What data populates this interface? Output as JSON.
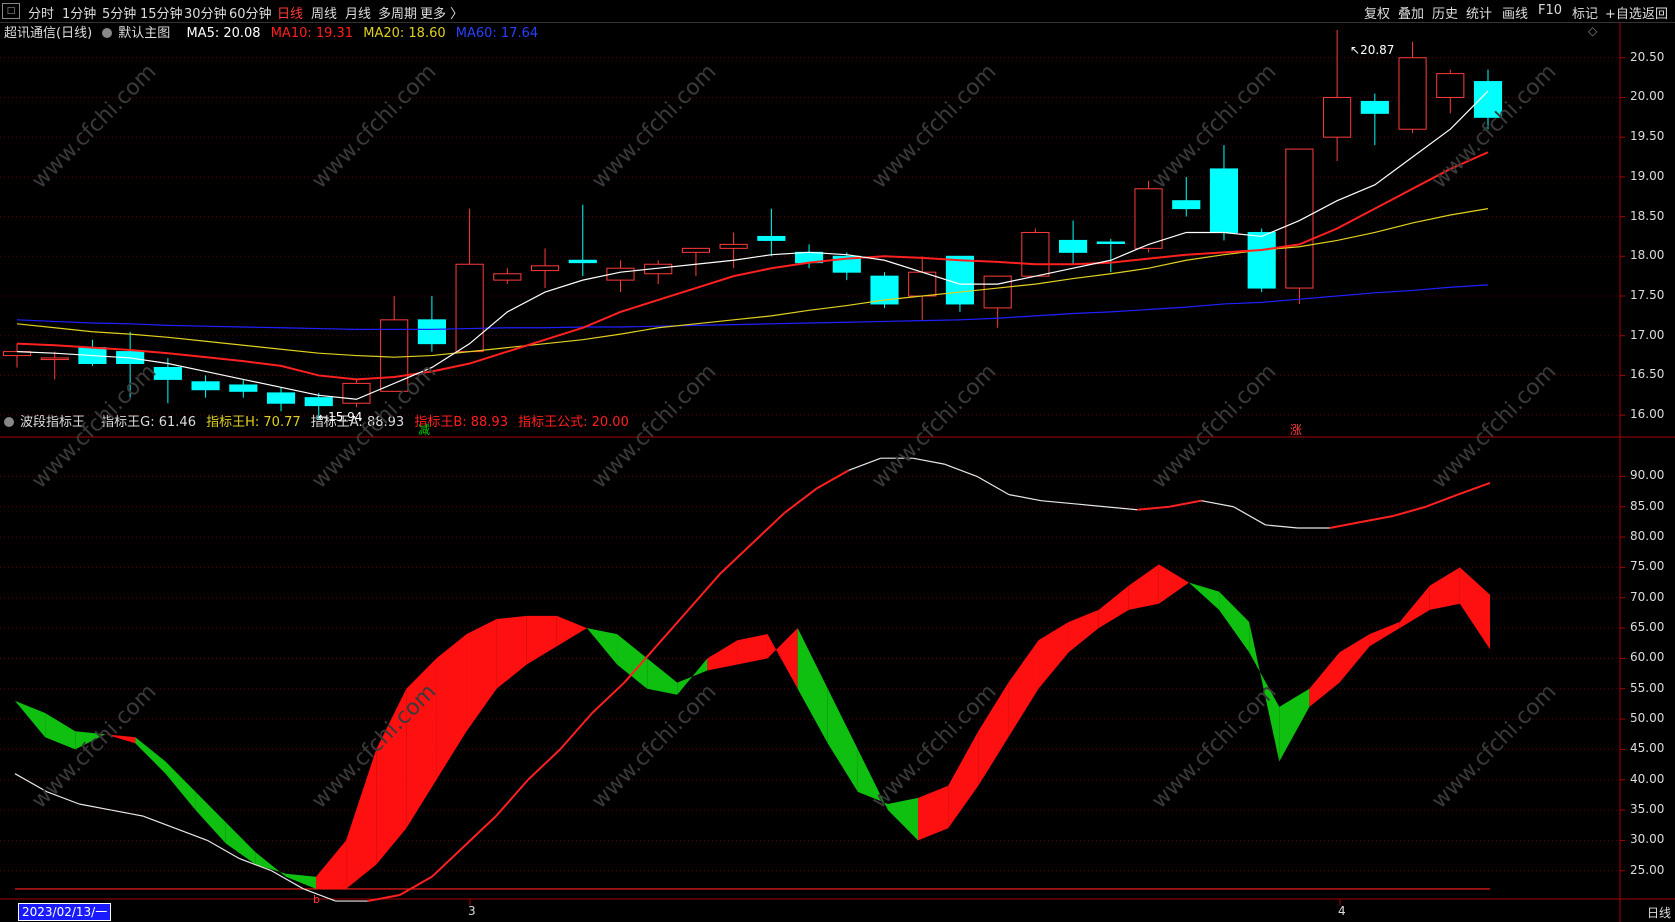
{
  "toolbar": {
    "periods": [
      "分时",
      "1分钟",
      "5分钟",
      "15分钟",
      "30分钟",
      "60分钟",
      "日线",
      "周线",
      "月线",
      "多周期",
      "更多 〉"
    ],
    "active_period": "日线",
    "right_tools": [
      "复权",
      "叠加",
      "历史",
      "统计",
      "画线",
      "F10",
      "标记",
      "+自选",
      "返回"
    ]
  },
  "main_legend": {
    "stock": "超讯通信(日线)",
    "template": "默认主图",
    "ma5": "MA5: 20.08",
    "ma10": "MA10: 19.31",
    "ma20": "MA20: 18.60",
    "ma60": "MA60: 17.64"
  },
  "indicator_legend": {
    "name": "波段指标王",
    "g": "指标王G: 61.46",
    "h": "指标王H: 70.77",
    "a": "指标王A: 88.93",
    "b": "指标王B: 88.93",
    "formula": "指标王公式: 20.00"
  },
  "colors": {
    "up": "#ff3b3b",
    "down": "#00ffff",
    "ma5": "#ffffff",
    "ma10": "#ff2020",
    "ma20": "#e0d020",
    "ma60": "#2020ff",
    "fill_red": "#ff1010",
    "fill_green": "#10c010"
  },
  "price_axis": [
    "20.50",
    "20.00",
    "19.50",
    "19.00",
    "18.50",
    "18.00",
    "17.50",
    "17.00",
    "16.50",
    "16.00"
  ],
  "indicator_axis": [
    "90.00",
    "85.00",
    "80.00",
    "75.00",
    "70.00",
    "65.00",
    "60.00",
    "55.00",
    "50.00",
    "45.00",
    "40.00",
    "35.00",
    "30.00",
    "25.00"
  ],
  "annotations": {
    "high": "20.87",
    "low": "15.94",
    "signal_low": "减",
    "signal_high": "涨",
    "b_marker": "b"
  },
  "x_axis": {
    "date": "2023/02/13/一",
    "m3": "3",
    "m4": "4",
    "period": "日线"
  },
  "watermark": "www.cfchi.com",
  "chart_data": {
    "type": "candlestick",
    "ylim": [
      15.75,
      20.95
    ],
    "candles": [
      [
        16.75,
        16.8,
        16.9,
        16.6
      ],
      [
        16.7,
        16.72,
        16.8,
        16.45
      ],
      [
        16.85,
        16.65,
        16.95,
        16.62
      ],
      [
        16.8,
        16.65,
        17.05,
        16.2
      ],
      [
        16.6,
        16.45,
        16.72,
        16.15
      ],
      [
        16.42,
        16.32,
        16.5,
        16.22
      ],
      [
        16.38,
        16.3,
        16.45,
        16.22
      ],
      [
        16.28,
        16.15,
        16.35,
        16.05
      ],
      [
        16.22,
        16.12,
        16.28,
        15.94
      ],
      [
        16.15,
        16.4,
        16.45,
        16.1
      ],
      [
        16.3,
        17.2,
        17.5,
        16.3
      ],
      [
        17.2,
        16.9,
        17.5,
        16.8
      ],
      [
        16.8,
        17.9,
        18.6,
        16.8
      ],
      [
        17.7,
        17.78,
        17.85,
        17.65
      ],
      [
        17.82,
        17.88,
        18.1,
        17.6
      ],
      [
        17.95,
        17.92,
        18.65,
        17.75
      ],
      [
        17.7,
        17.85,
        17.95,
        17.55
      ],
      [
        17.78,
        17.9,
        17.95,
        17.65
      ],
      [
        18.05,
        18.1,
        18.1,
        17.75
      ],
      [
        18.1,
        18.15,
        18.3,
        17.85
      ],
      [
        18.25,
        18.2,
        18.6,
        18.0
      ],
      [
        18.05,
        17.92,
        18.15,
        17.85
      ],
      [
        18.0,
        17.8,
        18.05,
        17.7
      ],
      [
        17.75,
        17.4,
        17.8,
        17.35
      ],
      [
        17.5,
        17.8,
        18.0,
        17.2
      ],
      [
        18.0,
        17.4,
        18.0,
        17.3
      ],
      [
        17.35,
        17.75,
        17.75,
        17.1
      ],
      [
        17.75,
        18.3,
        18.35,
        17.75
      ],
      [
        18.2,
        18.05,
        18.45,
        17.9
      ],
      [
        18.18,
        18.17,
        18.22,
        17.8
      ],
      [
        18.1,
        18.85,
        18.95,
        18.05
      ],
      [
        18.7,
        18.6,
        19.0,
        18.5
      ],
      [
        19.1,
        18.3,
        19.4,
        18.2
      ],
      [
        18.3,
        17.6,
        18.35,
        17.55
      ],
      [
        17.6,
        19.35,
        19.35,
        17.4
      ],
      [
        19.5,
        20.0,
        20.85,
        19.2
      ],
      [
        19.95,
        19.8,
        20.05,
        19.4
      ],
      [
        19.6,
        20.5,
        20.7,
        19.55
      ],
      [
        20.0,
        20.3,
        20.35,
        19.8
      ],
      [
        20.2,
        19.75,
        20.35,
        19.6
      ]
    ],
    "ma5": [
      16.8,
      16.78,
      16.75,
      16.72,
      16.65,
      16.55,
      16.45,
      16.35,
      16.25,
      16.2,
      16.4,
      16.6,
      16.9,
      17.3,
      17.55,
      17.7,
      17.8,
      17.85,
      17.9,
      17.95,
      18.02,
      18.05,
      18.02,
      17.95,
      17.8,
      17.65,
      17.65,
      17.75,
      17.85,
      17.95,
      18.15,
      18.3,
      18.3,
      18.25,
      18.45,
      18.7,
      18.9,
      19.25,
      19.6,
      20.08
    ],
    "ma10": [
      16.9,
      16.88,
      16.85,
      16.82,
      16.78,
      16.73,
      16.68,
      16.62,
      16.5,
      16.45,
      16.48,
      16.55,
      16.65,
      16.8,
      16.95,
      17.1,
      17.3,
      17.45,
      17.6,
      17.75,
      17.85,
      17.92,
      17.97,
      18.0,
      17.98,
      17.95,
      17.93,
      17.9,
      17.9,
      17.92,
      17.97,
      18.02,
      18.05,
      18.08,
      18.15,
      18.35,
      18.6,
      18.85,
      19.1,
      19.31
    ],
    "ma20": [
      17.15,
      17.1,
      17.05,
      17.02,
      16.98,
      16.93,
      16.88,
      16.83,
      16.78,
      16.75,
      16.73,
      16.75,
      16.8,
      16.85,
      16.9,
      16.95,
      17.02,
      17.1,
      17.15,
      17.2,
      17.25,
      17.32,
      17.38,
      17.45,
      17.5,
      17.55,
      17.6,
      17.65,
      17.72,
      17.78,
      17.85,
      17.95,
      18.02,
      18.08,
      18.12,
      18.2,
      18.3,
      18.42,
      18.52,
      18.6
    ],
    "ma60": [
      17.2,
      17.18,
      17.16,
      17.15,
      17.13,
      17.12,
      17.11,
      17.1,
      17.09,
      17.08,
      17.08,
      17.08,
      17.09,
      17.1,
      17.1,
      17.11,
      17.11,
      17.12,
      17.13,
      17.14,
      17.15,
      17.16,
      17.17,
      17.18,
      17.19,
      17.2,
      17.22,
      17.25,
      17.28,
      17.3,
      17.33,
      17.36,
      17.4,
      17.42,
      17.46,
      17.5,
      17.54,
      17.57,
      17.61,
      17.64
    ],
    "ind_ylim": [
      21,
      96
    ],
    "ind_upper": [
      53,
      51,
      48,
      47.5,
      46,
      41,
      35,
      29.5,
      26,
      24.5,
      24,
      30,
      45,
      55,
      60,
      64,
      66.5,
      67,
      67,
      65,
      59,
      55,
      54,
      60,
      63,
      64,
      55,
      46,
      38,
      36,
      37,
      39,
      48,
      56,
      63,
      66,
      68,
      72,
      75.5,
      72.5,
      68,
      61,
      52,
      55,
      61,
      64,
      66,
      72,
      75,
      70.5
    ],
    "ind_lower": [
      53,
      47,
      45,
      47.5,
      47,
      43,
      38,
      33,
      28,
      24,
      22,
      22,
      26,
      32,
      40,
      48,
      55,
      59,
      62,
      65,
      64,
      60,
      56,
      58,
      59,
      60,
      65,
      55,
      45,
      35,
      30,
      32,
      39,
      47,
      55,
      61,
      65,
      68,
      69,
      72.5,
      71,
      66,
      43,
      52,
      56,
      62,
      65,
      68,
      69,
      61.5
    ],
    "ind_fill_up": [
      false,
      false,
      false,
      true,
      false,
      false,
      false,
      false,
      false,
      false,
      true,
      true,
      true,
      true,
      true,
      true,
      true,
      true,
      true,
      false,
      false,
      false,
      false,
      true,
      true,
      true,
      false,
      false,
      false,
      false,
      true,
      true,
      true,
      true,
      true,
      true,
      true,
      true,
      true,
      false,
      false,
      false,
      false,
      true,
      true,
      true,
      true,
      true,
      true,
      false
    ],
    "ind_a": [
      41,
      38,
      36,
      35,
      34,
      32,
      30,
      27,
      25,
      22,
      20,
      20,
      21,
      24,
      29,
      34,
      40,
      45,
      51,
      56,
      62,
      68,
      74,
      79,
      84,
      88,
      91,
      93,
      93,
      92,
      90,
      87,
      86,
      85.5,
      85,
      84.5,
      85,
      86,
      85,
      82,
      81.5,
      81.5,
      82.5,
      83.5,
      85,
      87,
      88.93
    ],
    "ind_a_red_from": 11
  }
}
